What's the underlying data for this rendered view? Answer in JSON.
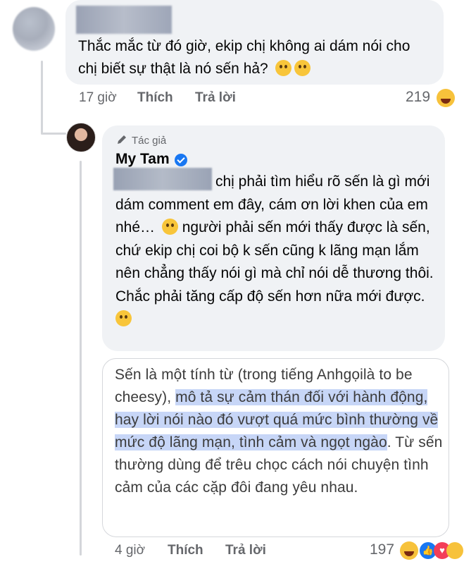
{
  "comment1": {
    "text": "Thắc mắc từ đó giờ, ekip chị không ai dám nói cho chị biết sự thật là nó sến hả?",
    "time": "17 giờ",
    "like_label": "Thích",
    "reply_label": "Trả lời",
    "reaction_count": "219"
  },
  "comment2": {
    "author_tag": "Tác giả",
    "author_name": "My Tam",
    "text_part1": "chị phải tìm hiểu rõ sến là gì mới dám comment em đây, cám ơn lời khen của em nhé…",
    "text_part2": "người phải sến mới thấy được là sến, chứ ekip chị coi bộ k sến cũng k lãng mạn lắm nên chẳng thấy nói gì mà chỉ nói dễ thương thôi. Chắc phải tăng cấp độ sến hơn nữa mới được.",
    "quote_part1": "Sến là một tính từ (trong tiếng Anh",
    "quote_glyph": "ɡọ",
    "quote_part1b": "ilà to be cheesy), ",
    "quote_highlight": "mô tả sự cảm thán đối với hành động, hay lời nói nào đó vượt quá mức bình thường về mức độ lãng mạn, tình cảm và ngọt ngào",
    "quote_part2": ". Từ sến thường dùng để trêu chọc cách nói chuyện tình cảm của các cặp đôi đang yêu nhau.",
    "time": "4 giờ",
    "like_label": "Thích",
    "reply_label": "Trả lời",
    "reaction_count": "197"
  },
  "colors": {
    "bubble": "#f0f2f5",
    "meta": "#65676b",
    "verified": "#1877f2",
    "highlight": "#c7d6f7"
  }
}
